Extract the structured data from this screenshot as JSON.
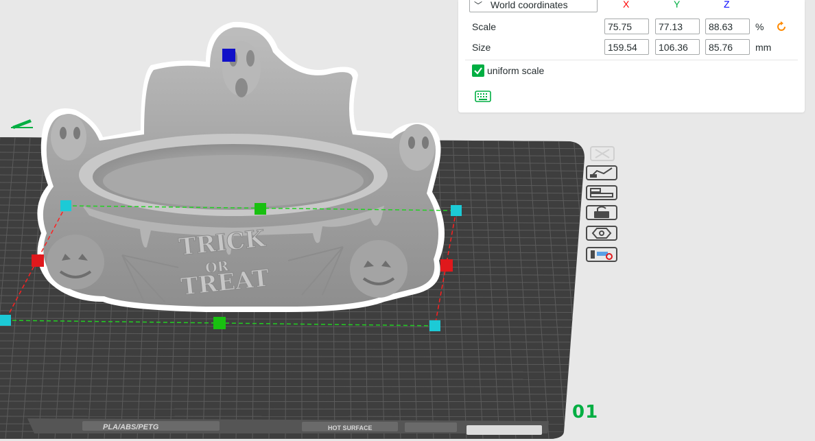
{
  "scale_panel": {
    "coordinate_system": "World coordinates",
    "axes": {
      "x": "X",
      "y": "Y",
      "z": "Z"
    },
    "axis_colors": {
      "x": "#ff0000",
      "y": "#00ae42",
      "z": "#0000ff"
    },
    "scale": {
      "label": "Scale",
      "x": "75.75",
      "y": "77.13",
      "z": "88.63",
      "unit": "%"
    },
    "size": {
      "label": "Size",
      "x": "159.54",
      "y": "106.36",
      "z": "85.76",
      "unit": "mm"
    },
    "uniform_scale": {
      "label": "uniform scale",
      "checked": true
    },
    "icons": {
      "reset": "reset-arrow-icon",
      "keyboard": "keyboard-icon"
    }
  },
  "plate": {
    "number": "01",
    "filament_label": "PLA/ABS/PETG",
    "surface_label": "HOT SURFACE"
  },
  "model": {
    "emboss_line1": "TRICK",
    "emboss_line2": "OR",
    "emboss_line3": "TREAT"
  },
  "toolbar": {
    "icons": [
      "close-icon",
      "auto-arrange-icon",
      "orient-icon",
      "lock-icon",
      "plate-settings-icon",
      "slice-plate-icon"
    ]
  },
  "colors": {
    "accent": "#00ae42",
    "bed": "#3e3e3e",
    "background": "#e8e8e8",
    "handle_cyan": "#1ccad6",
    "handle_red": "#e0181c",
    "handle_green": "#18c010",
    "handle_blue": "#1010c8"
  }
}
